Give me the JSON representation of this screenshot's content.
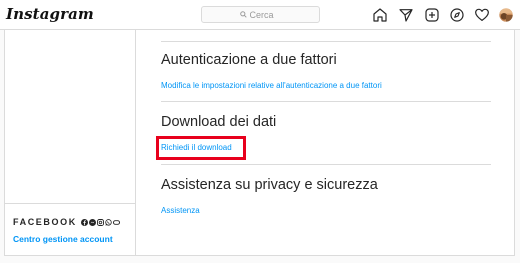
{
  "header": {
    "logo": "Instagram",
    "search": {
      "placeholder": "Cerca",
      "value": ""
    },
    "icons": [
      "home-icon",
      "direct-message-icon",
      "new-post-icon",
      "explore-icon",
      "activity-heart-icon",
      "profile-avatar"
    ]
  },
  "sidebar": {
    "facebook_label": "FACEBOOK",
    "facebook_icons": [
      "facebook-icon",
      "messenger-icon",
      "instagram-icon",
      "whatsapp-icon",
      "oculus-icon"
    ],
    "account_center": "Centro gestione account"
  },
  "main": {
    "sections": [
      {
        "title": "Autenticazione a due fattori",
        "link": "Modifica le impostazioni relative all'autenticazione a due fattori"
      },
      {
        "title": "Download dei dati",
        "link": "Richiedi il download"
      },
      {
        "title": "Assistenza su privacy e sicurezza",
        "link": "Assistenza"
      }
    ]
  },
  "colors": {
    "accent": "#0095f6",
    "highlight": "#e8001c",
    "border": "#dbdbdb",
    "background": "#fafafa"
  }
}
